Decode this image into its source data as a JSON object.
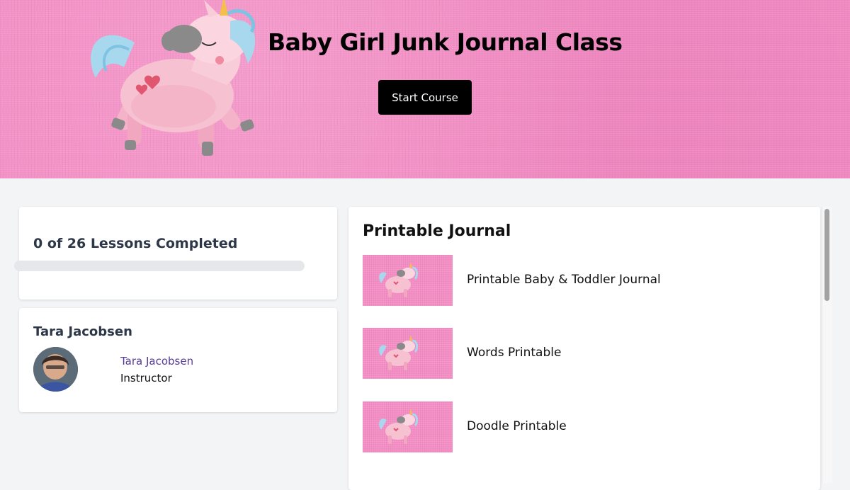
{
  "hero": {
    "title": "Baby Girl Junk Journal Class",
    "start_button": "Start Course",
    "background_color": "#f28ec4"
  },
  "progress": {
    "label": "0 of 26 Lessons Completed",
    "completed": 0,
    "total": 26
  },
  "instructor": {
    "heading": "Tara Jacobsen",
    "name": "Tara Jacobsen",
    "role": "Instructor",
    "link_color": "#553c9a"
  },
  "section": {
    "title": "Printable Journal",
    "lessons": [
      {
        "title": "Printable Baby & Toddler Journal",
        "thumbnail": "unicorn-thumbnail"
      },
      {
        "title": "Words Printable",
        "thumbnail": "unicorn-thumbnail"
      },
      {
        "title": "Doodle Printable",
        "thumbnail": "unicorn-thumbnail"
      }
    ]
  }
}
